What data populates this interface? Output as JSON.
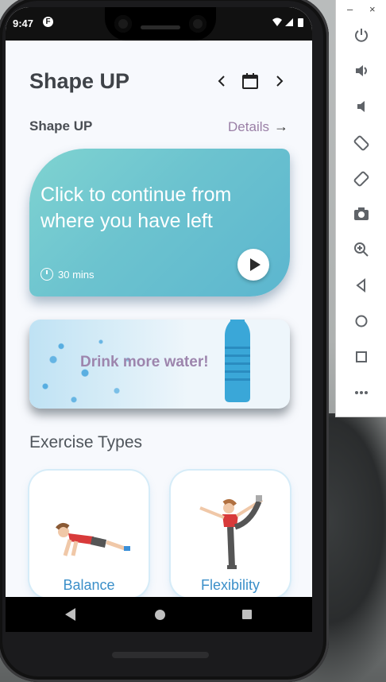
{
  "status": {
    "time": "9:47",
    "app_icon": "F"
  },
  "header": {
    "title": "Shape UP",
    "prev_icon": "chevron-left",
    "calendar_icon": "calendar",
    "next_icon": "chevron-right"
  },
  "section": {
    "title": "Shape UP",
    "details_label": "Details",
    "details_arrow": "→"
  },
  "continue_card": {
    "text": "Click to continue from where you have left",
    "duration": "30 mins"
  },
  "water_card": {
    "text": "Drink more water!"
  },
  "exercise": {
    "title": "Exercise Types",
    "types": [
      {
        "label": "Balance"
      },
      {
        "label": "Flexibility"
      }
    ]
  },
  "emulator": {
    "minimize": "–",
    "close": "×",
    "tools": [
      "power",
      "volume-up",
      "volume-down",
      "rotate-left",
      "rotate-right",
      "camera",
      "zoom",
      "back",
      "home",
      "overview",
      "more"
    ]
  },
  "colors": {
    "card_teal": "#6cc3cf",
    "accent_purple": "#9a7fa6",
    "exercise_blue": "#3b8fc9"
  }
}
